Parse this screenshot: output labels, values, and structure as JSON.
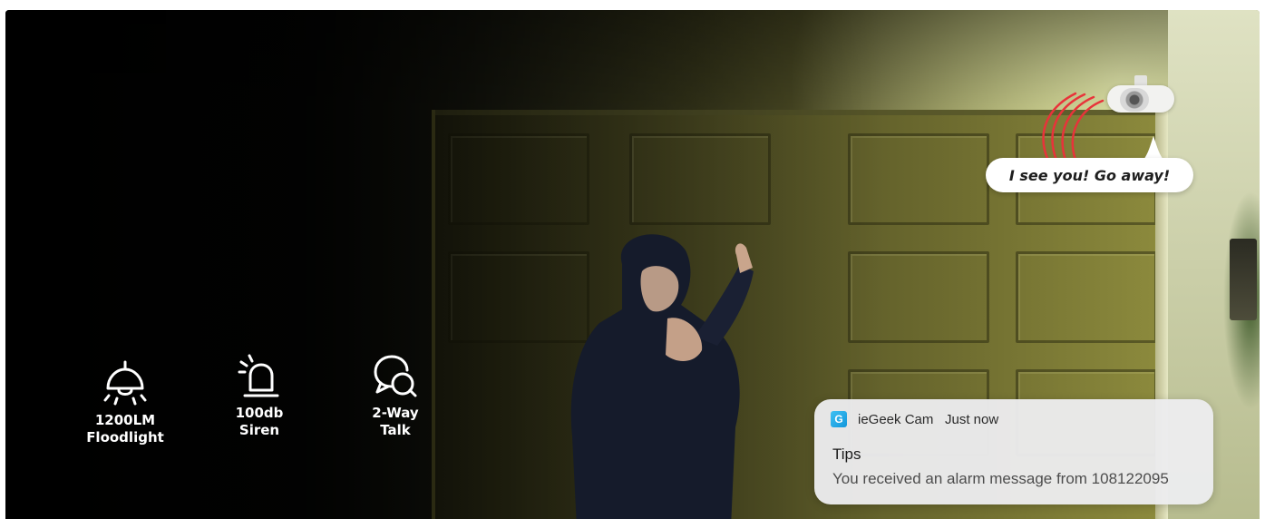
{
  "hero": {
    "speech_bubble": "I see you! Go away!",
    "features": [
      {
        "icon": "floodlight-icon",
        "line1": "1200LM",
        "line2": "Floodlight"
      },
      {
        "icon": "siren-icon",
        "line1": "100db",
        "line2": "Siren"
      },
      {
        "icon": "two-way-talk-icon",
        "line1": "2-Way",
        "line2": "Talk"
      }
    ]
  },
  "notification": {
    "app_icon_glyph": "G",
    "app_name": "ieGeek Cam",
    "time": "Just now",
    "title": "Tips",
    "body": "You received an alarm message from 108122095"
  },
  "colors": {
    "siren_wave": "#e8333a",
    "notification_bg": "#ececee",
    "app_icon": "#1aa7e6"
  }
}
